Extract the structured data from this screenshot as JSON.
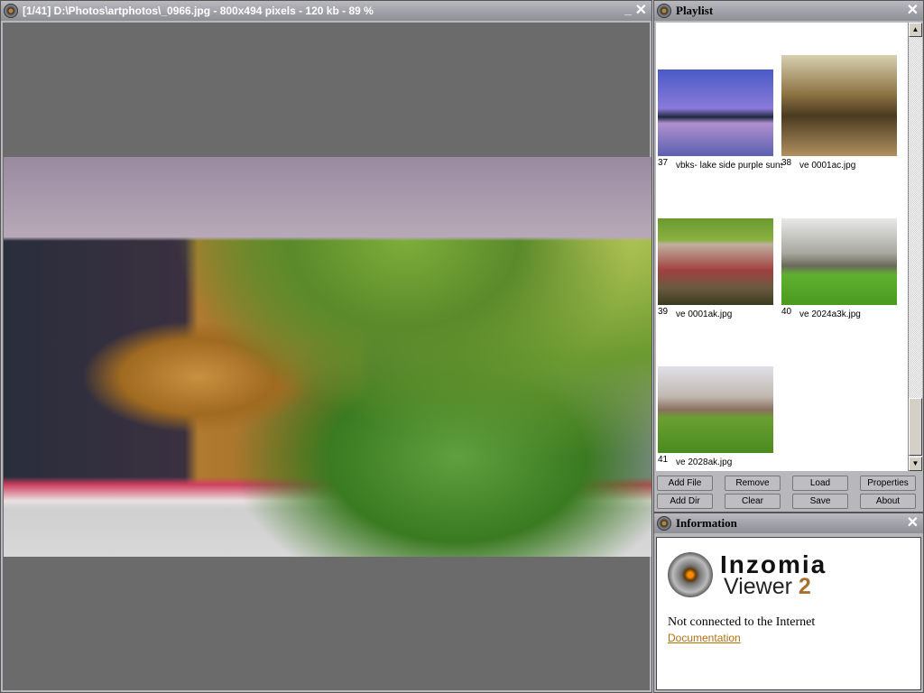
{
  "viewer": {
    "title": "[1/41] D:\\Photos\\artphotos\\_0966.jpg - 800x494 pixels - 120 kb - 89 %",
    "minimize": "_",
    "close": "✕"
  },
  "playlist": {
    "title": "Playlist",
    "close": "✕",
    "items": [
      {
        "num": "37",
        "name": "vbks- lake side purple sunset.jpg"
      },
      {
        "num": "38",
        "name": "ve 0001ac.jpg"
      },
      {
        "num": "39",
        "name": "ve 0001ak.jpg"
      },
      {
        "num": "40",
        "name": "ve 2024a3k.jpg"
      },
      {
        "num": "41",
        "name": "ve 2028ak.jpg"
      }
    ],
    "buttons": [
      "Add File",
      "Remove",
      "Load",
      "Properties",
      "Add Dir",
      "Clear",
      "Save",
      "About"
    ],
    "scroll_up": "▲",
    "scroll_down": "▼"
  },
  "information": {
    "title": "Information",
    "close": "✕",
    "brand_line1": "Inzomia",
    "brand_line2": "Viewer",
    "brand_version": "2",
    "status": "Not connected to the Internet",
    "link": "Documentation"
  }
}
